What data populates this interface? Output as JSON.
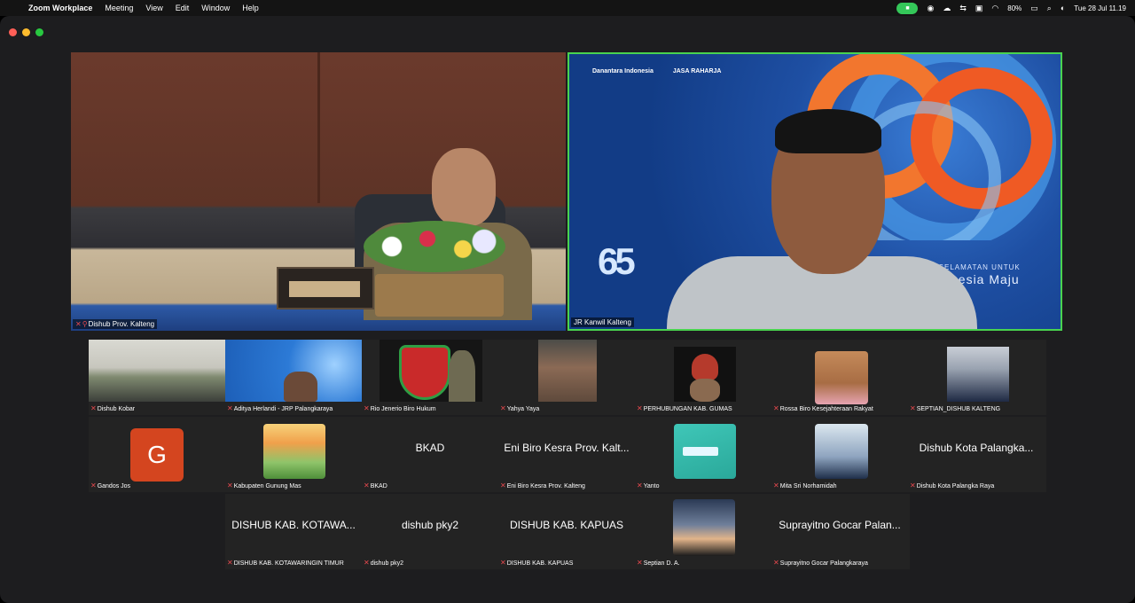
{
  "menubar": {
    "app": "Zoom Workplace",
    "items": [
      "Meeting",
      "View",
      "Edit",
      "Window",
      "Help"
    ],
    "battery": "80%",
    "datetime": "Tue 28 Jul  11.19"
  },
  "main": {
    "left_name": "Dishub Prov. Kalteng",
    "right_name": "JR Kanwil Kalteng",
    "right_brands": [
      "Danantara Indonesia",
      "JASA RAHARJA"
    ],
    "right_badge": "65",
    "right_tagline": "KESELAMATAN UNTUK",
    "right_tagline2": "nesia Maju"
  },
  "gallery": {
    "row1": [
      {
        "name": "Dishub Kobar"
      },
      {
        "name": "Aditya Herlandi - JRP Palangkaraya"
      },
      {
        "name": "Rio Jenerio Biro Hukum"
      },
      {
        "name": "Yahya Yaya"
      },
      {
        "name": "PERHUBUNGAN KAB. GUMAS"
      },
      {
        "name": "Rossa Biro Kesejahteraan Rakyat"
      },
      {
        "name": "SEPTIAN_DISHUB KALTENG"
      }
    ],
    "row2": [
      {
        "name": "Gandos Jos",
        "avatar_letter": "G"
      },
      {
        "name": "Kabupaten Gunung Mas"
      },
      {
        "name": "BKAD",
        "display": "BKAD"
      },
      {
        "name": "Eni Biro Kesra Prov. Kalteng",
        "display": "Eni Biro Kesra Prov. Kalt..."
      },
      {
        "name": "Yanto"
      },
      {
        "name": "Mita Sri Norhamidah"
      },
      {
        "name": "Dishub Kota Palangka Raya",
        "display": "Dishub Kota Palangka..."
      }
    ],
    "row3": [
      {
        "name": "DISHUB KAB. KOTAWARINGIN TIMUR",
        "display": "DISHUB KAB. KOTAWA..."
      },
      {
        "name": "dishub pky2",
        "display": "dishub pky2"
      },
      {
        "name": "DISHUB KAB. KAPUAS",
        "display": "DISHUB KAB. KAPUAS"
      },
      {
        "name": "Septian D. A."
      },
      {
        "name": "Suprayitno Gocar Palangkaraya",
        "display": "Suprayitno Gocar Palan..."
      }
    ]
  }
}
